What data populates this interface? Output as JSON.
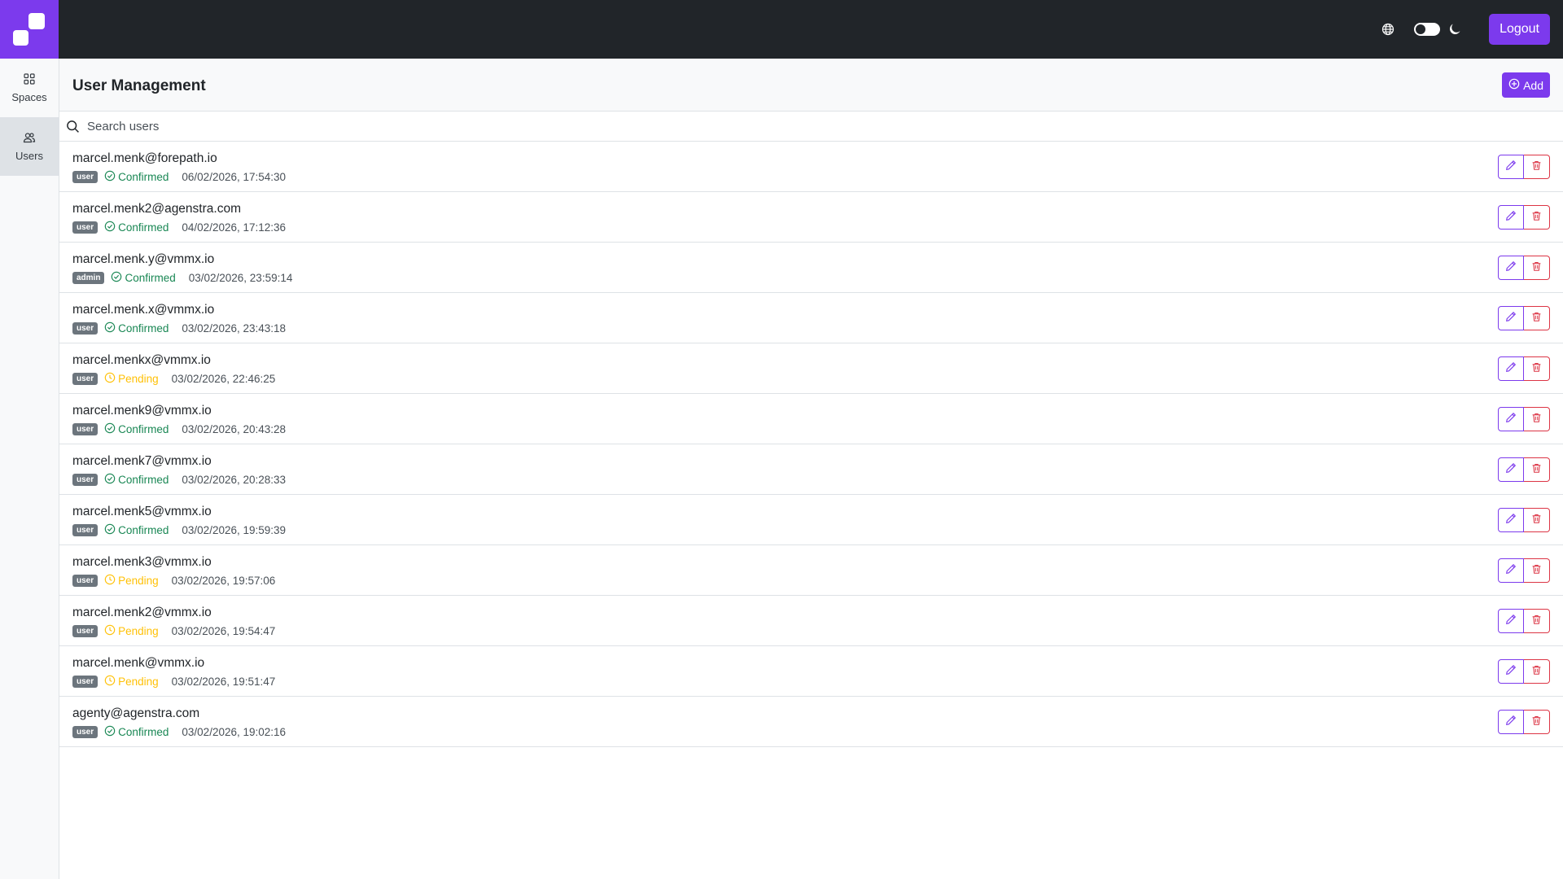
{
  "topbar": {
    "logout_label": "Logout",
    "icons": [
      "globe-icon",
      "moon-icon"
    ]
  },
  "sidebar": {
    "items": [
      {
        "label": "Spaces",
        "icon": "grid-icon"
      },
      {
        "label": "Users",
        "icon": "users-icon",
        "active": true
      }
    ]
  },
  "header": {
    "title": "User Management",
    "add_label": "Add"
  },
  "search": {
    "placeholder": "Search users"
  },
  "users": [
    {
      "email": "marcel.menk@forepath.io",
      "role": "user",
      "status": "Confirmed",
      "timestamp": "06/02/2026, 17:54:30"
    },
    {
      "email": "marcel.menk2@agenstra.com",
      "role": "user",
      "status": "Confirmed",
      "timestamp": "04/02/2026, 17:12:36"
    },
    {
      "email": "marcel.menk.y@vmmx.io",
      "role": "admin",
      "status": "Confirmed",
      "timestamp": "03/02/2026, 23:59:14"
    },
    {
      "email": "marcel.menk.x@vmmx.io",
      "role": "user",
      "status": "Confirmed",
      "timestamp": "03/02/2026, 23:43:18"
    },
    {
      "email": "marcel.menkx@vmmx.io",
      "role": "user",
      "status": "Pending",
      "timestamp": "03/02/2026, 22:46:25"
    },
    {
      "email": "marcel.menk9@vmmx.io",
      "role": "user",
      "status": "Confirmed",
      "timestamp": "03/02/2026, 20:43:28"
    },
    {
      "email": "marcel.menk7@vmmx.io",
      "role": "user",
      "status": "Confirmed",
      "timestamp": "03/02/2026, 20:28:33"
    },
    {
      "email": "marcel.menk5@vmmx.io",
      "role": "user",
      "status": "Confirmed",
      "timestamp": "03/02/2026, 19:59:39"
    },
    {
      "email": "marcel.menk3@vmmx.io",
      "role": "user",
      "status": "Pending",
      "timestamp": "03/02/2026, 19:57:06"
    },
    {
      "email": "marcel.menk2@vmmx.io",
      "role": "user",
      "status": "Pending",
      "timestamp": "03/02/2026, 19:54:47"
    },
    {
      "email": "marcel.menk@vmmx.io",
      "role": "user",
      "status": "Pending",
      "timestamp": "03/02/2026, 19:51:47"
    },
    {
      "email": "agenty@agenstra.com",
      "role": "user",
      "status": "Confirmed",
      "timestamp": "03/02/2026, 19:02:16"
    }
  ],
  "colors": {
    "accent": "#7c3aed",
    "topbar": "#212529",
    "confirmed": "#198754",
    "pending": "#ffc107",
    "danger": "#dc3545"
  }
}
